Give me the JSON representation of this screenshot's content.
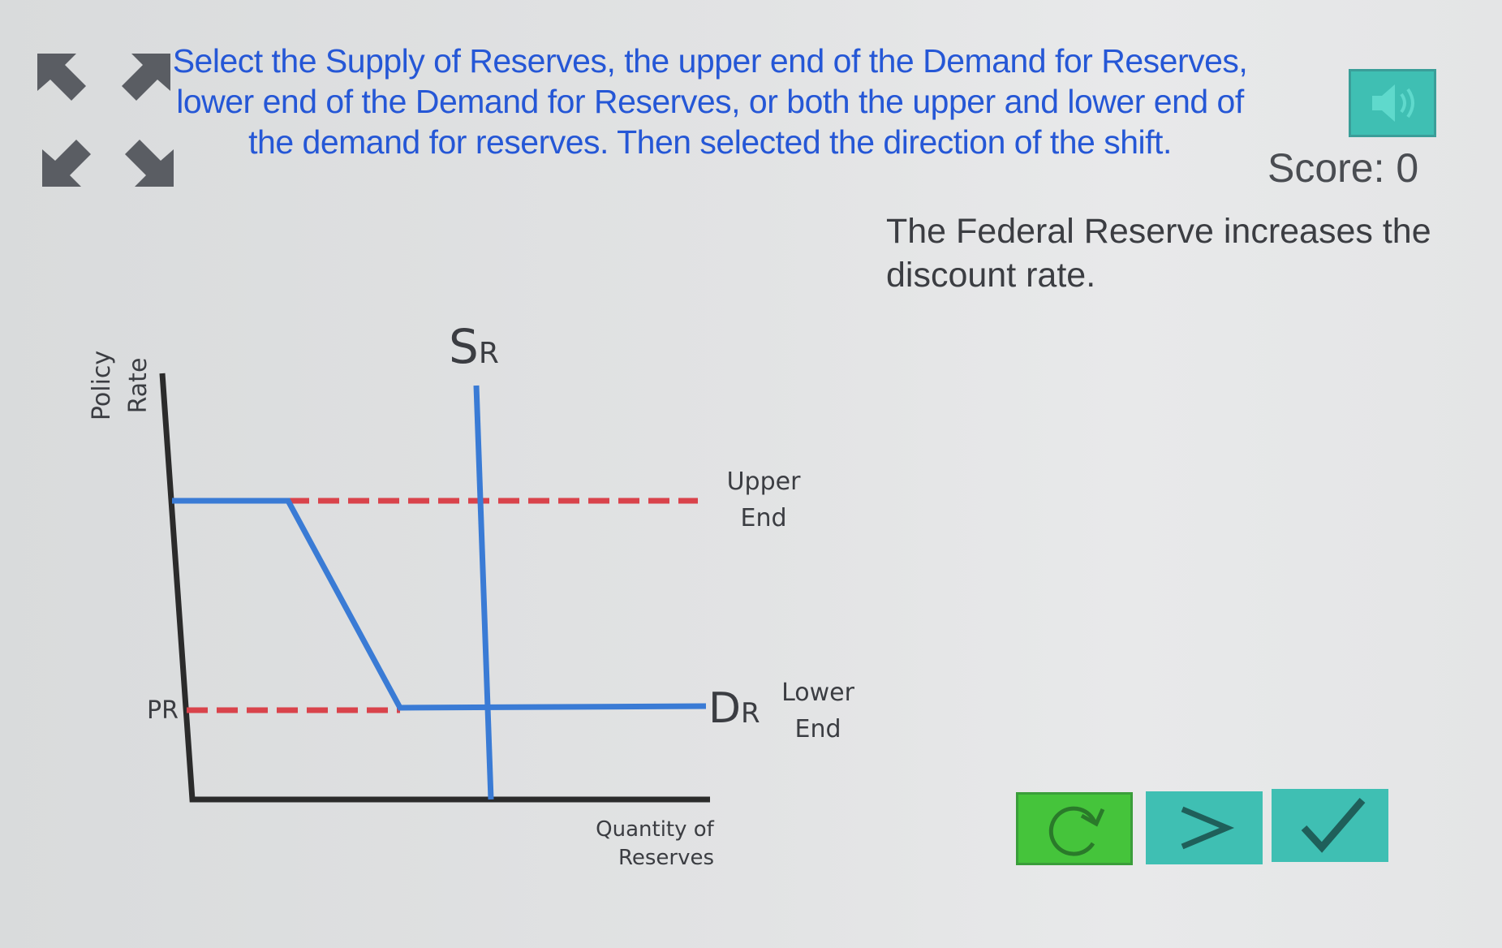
{
  "instruction": "Select the Supply of Reserves, the upper end of the Demand for Reserves, lower end of the Demand for Reserves, or both the upper and lower end of the demand for reserves. Then selected the direction of the shift.",
  "score": {
    "label": "Score:",
    "value": "0"
  },
  "scenario": "The Federal Reserve increases the discount rate.",
  "graph": {
    "y_axis_label_line1": "Policy",
    "y_axis_label_line2": "Rate",
    "x_axis_label_line1": "Quantity of",
    "x_axis_label_line2": "Reserves",
    "supply_label_main": "S",
    "supply_label_sub": "R",
    "demand_label_main": "D",
    "demand_label_sub": "R",
    "upper_end_line1": "Upper",
    "upper_end_line2": "End",
    "lower_end_line1": "Lower",
    "lower_end_line2": "End",
    "policy_rate_tick": "PR",
    "colors": {
      "curve": "#3a7bd5",
      "dashed": "#d9434b",
      "axis": "#2b2b2b"
    }
  },
  "buttons": {
    "reset_icon": "reset-icon",
    "next_icon": "chevron-right-icon",
    "check_icon": "checkmark-icon"
  },
  "colors": {
    "instruction": "#2557d6",
    "teal_button": "#3fbfb3",
    "green_button": "#45c43b"
  }
}
